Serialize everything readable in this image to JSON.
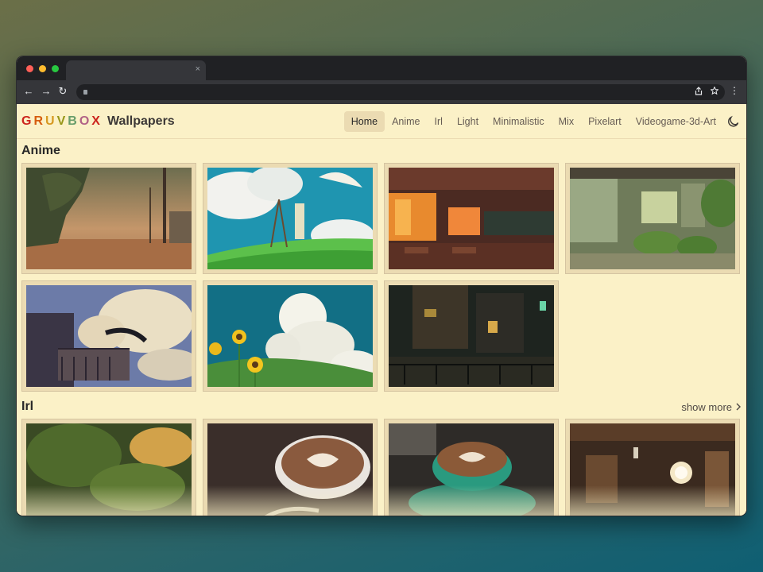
{
  "browser": {
    "tab_close": "×",
    "back": "←",
    "forward": "→",
    "reload": "↻",
    "menu": "⋮"
  },
  "site": {
    "brand_letters": [
      {
        "char": "G",
        "color": "#cc241d"
      },
      {
        "char": "R",
        "color": "#d65d0e"
      },
      {
        "char": "U",
        "color": "#d79921"
      },
      {
        "char": "V",
        "color": "#98971a"
      },
      {
        "char": "B",
        "color": "#689d6a"
      },
      {
        "char": "O",
        "color": "#b16286"
      },
      {
        "char": "X",
        "color": "#cc241d"
      }
    ],
    "brand_suffix": "Wallpapers",
    "nav": [
      "Home",
      "Anime",
      "Irl",
      "Light",
      "Minimalistic",
      "Mix",
      "Pixelart",
      "Videogame-3d-Art"
    ],
    "active_nav": "Home",
    "theme_icon": "moon-icon"
  },
  "sections": {
    "anime": {
      "title": "Anime",
      "wallpapers": [
        "dirt-road-sunset",
        "girl-painting-umbrella",
        "sunset-classroom",
        "japanese-garden-house",
        "girl-flying-clouds",
        "sunflowers-clouds",
        "night-street"
      ]
    },
    "irl": {
      "title": "Irl",
      "show_more": "show more",
      "wallpapers": [
        "forest-sunlight",
        "latte-art-cup",
        "coffee-cup-saucer",
        "cozy-cafe-interior"
      ]
    }
  },
  "colors": {
    "bg": "#fbf1c7",
    "accent": "#ebdbb2",
    "text": "#3c3836"
  }
}
